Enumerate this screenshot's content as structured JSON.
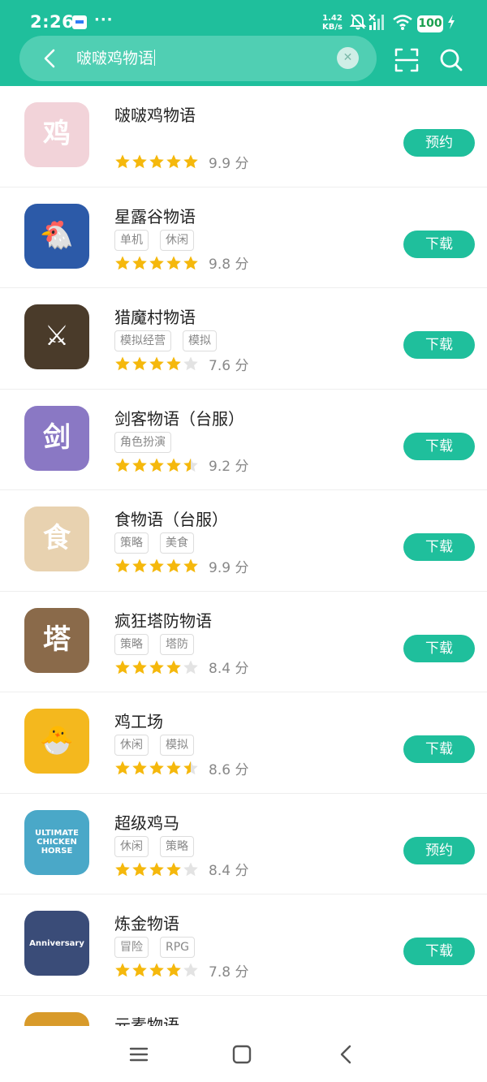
{
  "status_bar": {
    "time": "2:26",
    "notification_dots": "···",
    "net_speed_value": "1.42",
    "net_speed_unit": "KB/s",
    "battery": "100",
    "icons": [
      "message-icon",
      "bell-mute-icon",
      "signal-icon",
      "wifi-icon",
      "battery-icon",
      "charging-icon"
    ]
  },
  "search": {
    "query": "啵啵鸡物语",
    "icons": [
      "back-arrow-icon",
      "clear-icon",
      "scan-icon",
      "search-icon"
    ]
  },
  "colors": {
    "accent": "#1fbf9c",
    "star_filled": "#f5b80c",
    "star_empty": "#e3e3e3"
  },
  "apps": [
    {
      "name": "啵啵鸡物语",
      "tags": [],
      "stars": 5,
      "score": "9.9 分",
      "action": "预约",
      "icon_color": "#f2d3d9",
      "icon_glyph": "鸡"
    },
    {
      "name": "星露谷物语",
      "tags": [
        "单机",
        "休闲"
      ],
      "stars": 5,
      "score": "9.8 分",
      "action": "下载",
      "icon_color": "#2c5aa8",
      "icon_glyph": "🐔"
    },
    {
      "name": "猎魔村物语",
      "tags": [
        "模拟经营",
        "模拟"
      ],
      "stars": 4,
      "score": "7.6 分",
      "action": "下载",
      "icon_color": "#4a3b2a",
      "icon_glyph": "⚔"
    },
    {
      "name": "剑客物语（台服）",
      "tags": [
        "角色扮演"
      ],
      "stars": 4.5,
      "score": "9.2 分",
      "action": "下载",
      "icon_color": "#8a78c4",
      "icon_glyph": "剑"
    },
    {
      "name": "食物语（台服）",
      "tags": [
        "策略",
        "美食"
      ],
      "stars": 5,
      "score": "9.9 分",
      "action": "下载",
      "icon_color": "#e8d2b0",
      "icon_glyph": "食"
    },
    {
      "name": "疯狂塔防物语",
      "tags": [
        "策略",
        "塔防"
      ],
      "stars": 4,
      "score": "8.4 分",
      "action": "下载",
      "icon_color": "#8a6a4a",
      "icon_glyph": "塔"
    },
    {
      "name": "鸡工场",
      "tags": [
        "休闲",
        "模拟"
      ],
      "stars": 4.5,
      "score": "8.6 分",
      "action": "下载",
      "icon_color": "#f4b81e",
      "icon_glyph": "🐣"
    },
    {
      "name": "超级鸡马",
      "tags": [
        "休闲",
        "策略"
      ],
      "stars": 4,
      "score": "8.4 分",
      "action": "预约",
      "icon_color": "#4aa8c8",
      "icon_glyph": "ULTIMATE CHICKEN HORSE"
    },
    {
      "name": "炼金物语",
      "tags": [
        "冒险",
        "RPG"
      ],
      "stars": 4,
      "score": "7.8 分",
      "action": "下载",
      "icon_color": "#3a4c78",
      "icon_glyph": "Anniversary"
    },
    {
      "name": "元素物语",
      "tags": [],
      "stars": 0,
      "score": "",
      "action": "",
      "icon_color": "#d89a2a",
      "icon_glyph": ""
    }
  ],
  "nav": {
    "icons": [
      "menu-icon",
      "home-icon",
      "back-icon"
    ]
  }
}
